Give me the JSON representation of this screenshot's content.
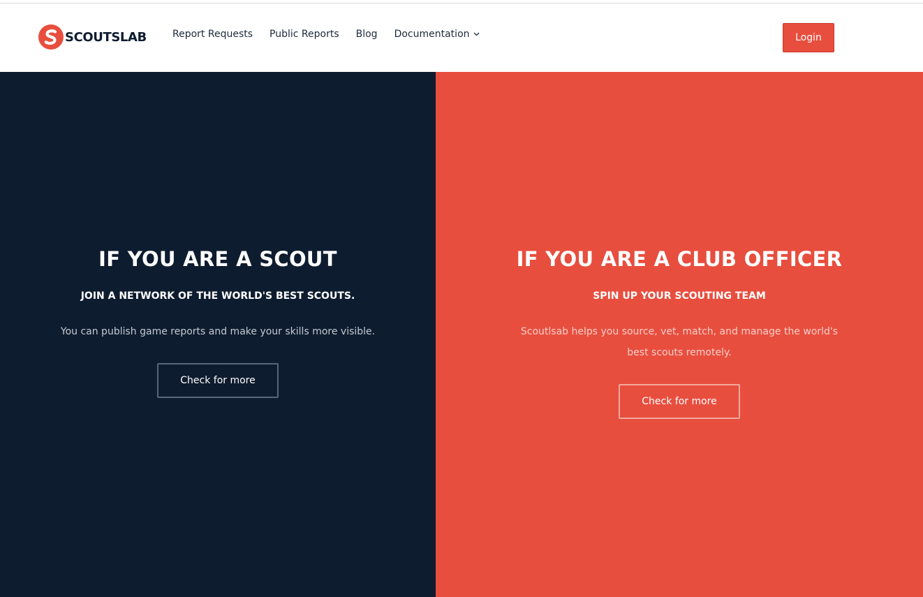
{
  "header": {
    "logo_text": "SCOUTSLAB",
    "nav": [
      {
        "label": "Report Requests"
      },
      {
        "label": "Public Reports"
      },
      {
        "label": "Blog"
      },
      {
        "label": "Documentation",
        "icon": "chevron-down-icon"
      }
    ],
    "login_label": "Login"
  },
  "scout_panel": {
    "title": "IF YOU ARE A SCOUT",
    "subtitle": "JOIN A NETWORK OF THE WORLD'S BEST SCOUTS.",
    "description": "You can publish game reports and make your skills more visible.",
    "button_label": "Check for more"
  },
  "club_panel": {
    "title": "IF YOU ARE A CLUB OFFICER",
    "subtitle": "SPIN UP YOUR SCOUTING TEAM",
    "description": "Scoutlsab helps you source, vet, match, and manage the world's best scouts remotely.",
    "button_label": "Check for more"
  },
  "colors": {
    "brand_red": "#e84e3e",
    "navy": "#0e1c2f"
  }
}
